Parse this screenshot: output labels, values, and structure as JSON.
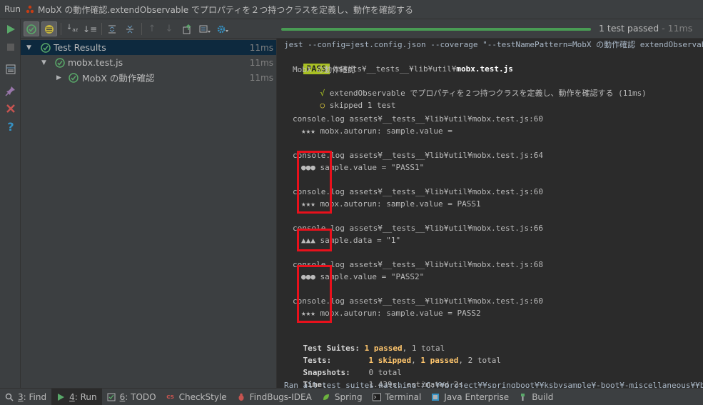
{
  "title": {
    "run_label": "Run",
    "text": "MobX の動作確認.extendObservable でプロパティを２つ持つクラスを定義し、動作を確認する"
  },
  "toolbar": {
    "status_passed": "1 test passed",
    "status_time": " - 11ms"
  },
  "tree": {
    "items": [
      {
        "label": "Test Results",
        "time": "11ms"
      },
      {
        "label": "mobx.test.js",
        "time": "11ms"
      },
      {
        "label": "MobX の動作確認",
        "time": "11ms"
      }
    ]
  },
  "console": {
    "command": "jest --config=jest.config.json --coverage \"--testNamePattern=MobX の動作確認 extendObservable でプ",
    "pass_badge": "PASS",
    "pass_path": "assets¥__tests__¥lib¥util¥",
    "pass_file": "mobx.test.js",
    "describe": "MobX の動作確認",
    "check_mark": "√",
    "test_name": "extendObservable でプロパティを２つ持つクラスを定義し、動作を確認する (11ms)",
    "skip_mark": "○",
    "skipped": "skipped 1 test",
    "logs": [
      {
        "header": "console.log assets¥__tests__¥lib¥util¥mobx.test.js:60",
        "body": "★★★ mobx.autorun: sample.value ="
      },
      {
        "header": "console.log assets¥__tests__¥lib¥util¥mobx.test.js:64",
        "body": "●●● sample.value = \"PASS1\""
      },
      {
        "header": "console.log assets¥__tests__¥lib¥util¥mobx.test.js:60",
        "body": "★★★ mobx.autorun: sample.value = PASS1"
      },
      {
        "header": "console.log assets¥__tests__¥lib¥util¥mobx.test.js:66",
        "body": "▲▲▲ sample.data = \"1\""
      },
      {
        "header": "console.log assets¥__tests__¥lib¥util¥mobx.test.js:68",
        "body": "●●● sample.value = \"PASS2\""
      },
      {
        "header": "console.log assets¥__tests__¥lib¥util¥mobx.test.js:60",
        "body": "★★★ mobx.autorun: sample.value = PASS2"
      }
    ],
    "summary": {
      "suites_label": "Test Suites:",
      "suites_passed": "1 passed",
      "suites_rest": ", 1 total",
      "tests_label": "Tests:",
      "tests_skipped": "1 skipped",
      "tests_sep": ", ",
      "tests_passed": "1 passed",
      "tests_rest": ", 2 total",
      "snapshots_label": "Snapshots:",
      "snapshots_value": "0 total",
      "time_label": "Time:",
      "time_value": "1.439s, estimated 2s",
      "ran_all": "Ran all test suites matching /C:¥¥project¥¥springboot¥¥ksbysample¥-boot¥-miscellaneous¥¥boot¥-npm"
    }
  },
  "bottom_tabs": [
    {
      "key": "3",
      "label": ": Find",
      "icon": "search-icon"
    },
    {
      "key": "4",
      "label": ": Run",
      "icon": "run-icon"
    },
    {
      "key": "6",
      "label": ": TODO",
      "icon": "todo-icon"
    },
    {
      "key": "",
      "label": "CheckStyle",
      "icon": "checkstyle-icon"
    },
    {
      "key": "",
      "label": "FindBugs-IDEA",
      "icon": "findbugs-icon"
    },
    {
      "key": "",
      "label": "Spring",
      "icon": "spring-icon"
    },
    {
      "key": "",
      "label": "Terminal",
      "icon": "terminal-icon"
    },
    {
      "key": "",
      "label": "Java Enterprise",
      "icon": "java-enterprise-icon"
    },
    {
      "key": "",
      "label": "Build",
      "icon": "build-icon"
    }
  ],
  "colors": {
    "pass_green": "#499c54",
    "badge_green": "#a8c023",
    "highlight_red": "#e8111c",
    "summary_yellow": "#ffc66d"
  }
}
